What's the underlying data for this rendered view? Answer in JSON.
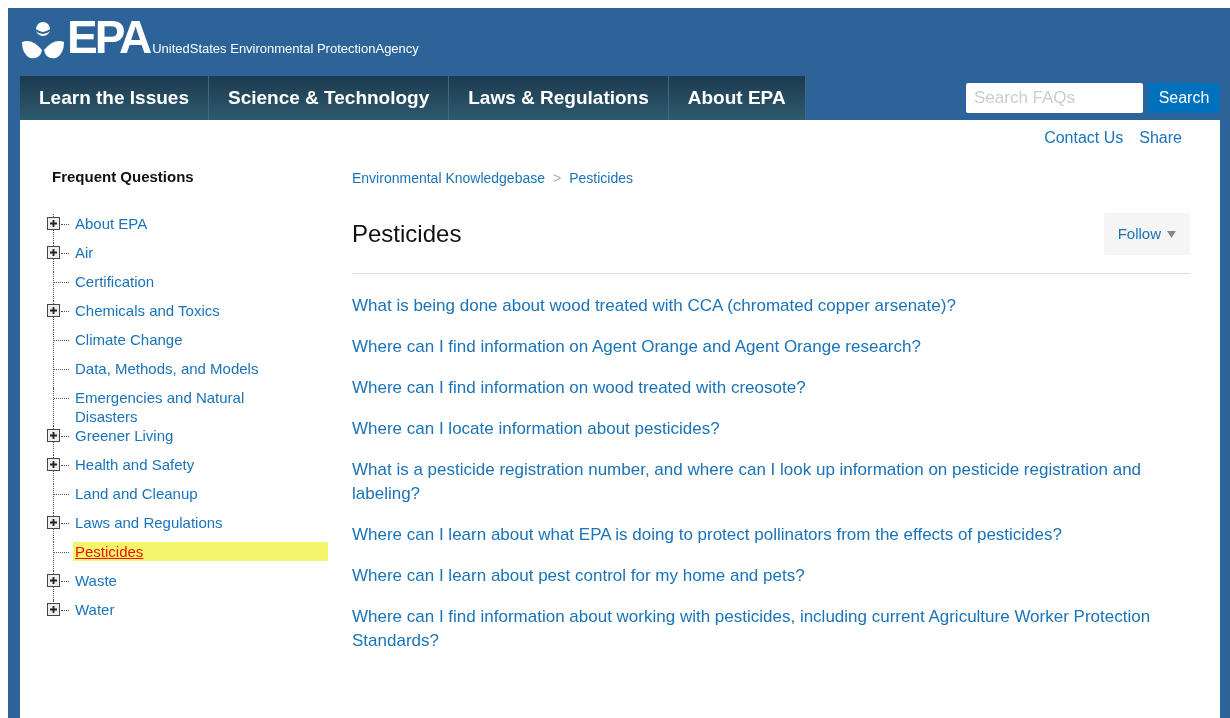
{
  "header": {
    "agency": "EPA",
    "agency_full": "UnitedStates Environmental ProtectionAgency"
  },
  "nav": [
    {
      "label": "Learn the Issues"
    },
    {
      "label": "Science & Technology"
    },
    {
      "label": "Laws & Regulations"
    },
    {
      "label": "About EPA"
    }
  ],
  "search": {
    "placeholder": "Search FAQs",
    "button": "Search"
  },
  "utility_links": [
    "Contact Us",
    "Share"
  ],
  "sidebar": {
    "title": "Frequent Questions",
    "items": [
      {
        "label": "About EPA",
        "kind": "folder",
        "selected": false
      },
      {
        "label": "Air",
        "kind": "folder",
        "selected": false
      },
      {
        "label": "Certification",
        "kind": "leaf",
        "selected": false
      },
      {
        "label": "Chemicals and Toxics",
        "kind": "folder",
        "selected": false
      },
      {
        "label": "Climate Change",
        "kind": "leaf",
        "selected": false
      },
      {
        "label": "Data, Methods, and Models",
        "kind": "leaf",
        "selected": false
      },
      {
        "label": "Emergencies and Natural Disasters",
        "kind": "leaf",
        "selected": false
      },
      {
        "label": "Greener Living",
        "kind": "folder",
        "selected": false
      },
      {
        "label": "Health and Safety",
        "kind": "folder",
        "selected": false
      },
      {
        "label": "Land and Cleanup",
        "kind": "leaf",
        "selected": false
      },
      {
        "label": "Laws and Regulations",
        "kind": "folder",
        "selected": false
      },
      {
        "label": "Pesticides",
        "kind": "leaf",
        "selected": true
      },
      {
        "label": "Waste",
        "kind": "folder",
        "selected": false
      },
      {
        "label": "Water",
        "kind": "folder",
        "selected": false
      }
    ]
  },
  "breadcrumb": [
    {
      "label": "Environmental Knowledgebase"
    },
    {
      "label": "Pesticides"
    }
  ],
  "breadcrumb_separator": ">",
  "page_title": "Pesticides",
  "follow_button": "Follow",
  "questions": [
    "What is being done about wood treated with CCA (chromated copper arsenate)?",
    "Where can I find information on Agent Orange and Agent Orange research?",
    "Where can I find information on wood treated with creosote?",
    "Where can I locate information about pesticides?",
    "What is a pesticide registration number, and where can I look up information on pesticide registration and labeling?",
    "Where can I learn about what EPA is doing to protect pollinators from the effects of pesticides?",
    "Where can I learn about pest control for my home and pets?",
    "Where can I find information about working with pesticides, including current Agriculture Worker Protection Standards?"
  ]
}
